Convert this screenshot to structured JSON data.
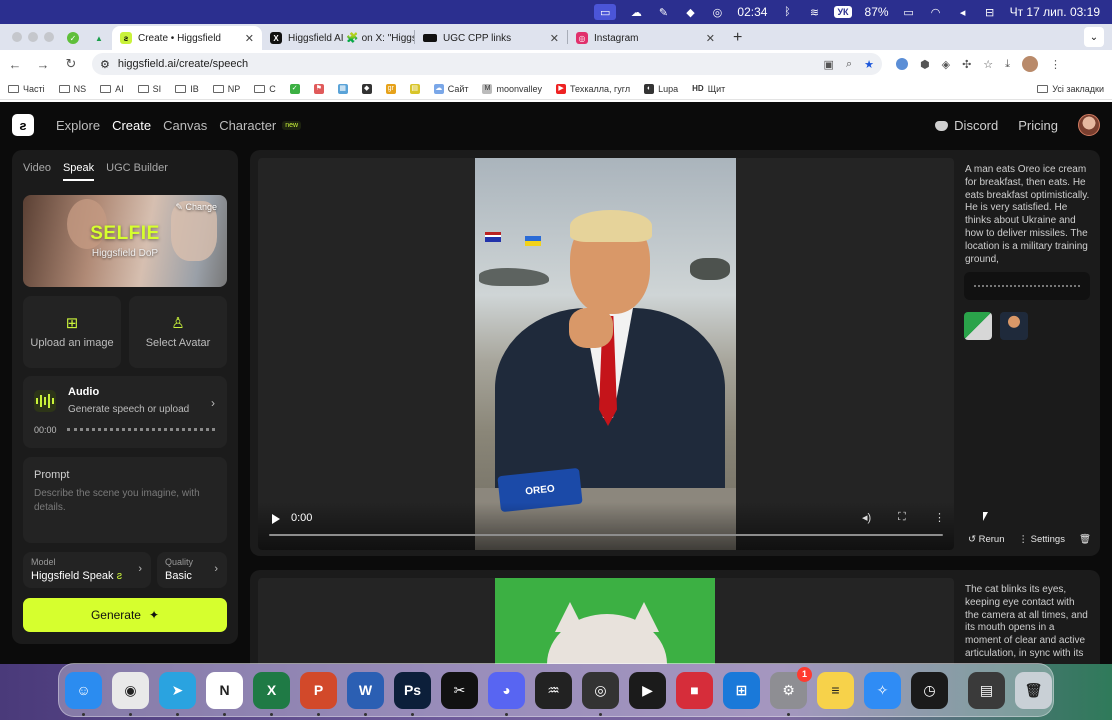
{
  "menubar": {
    "time": "02:34",
    "lang": "УК",
    "battery": "87%",
    "datetime": "Чт 17 лип.  03:19"
  },
  "browser": {
    "tabs": [
      {
        "label": "Create • Higgsfield",
        "active": true,
        "favicon_color": "#c9f23a"
      },
      {
        "label": "Higgsfield AI 🧩 on X: \"Higgs",
        "active": false,
        "favicon_color": "#111111"
      },
      {
        "label": "UGC CPP links",
        "active": false,
        "favicon_color": "#111111"
      },
      {
        "label": "Instagram",
        "active": false,
        "favicon_color": "#e1306c"
      }
    ],
    "url": "higgsfield.ai/create/speech",
    "bookmarks": [
      "Часті",
      "NS",
      "AI",
      "SI",
      "IB",
      "NP",
      "C",
      "",
      "",
      "",
      "",
      "",
      "Сайт",
      "moonvalley",
      "Техкалла, гугл",
      "Lupa",
      "Щит"
    ],
    "all_bookmarks": "Усі закладки"
  },
  "nav": {
    "links": [
      "Explore",
      "Create",
      "Canvas",
      "Character"
    ],
    "new_badge": "new",
    "discord": "Discord",
    "pricing": "Pricing"
  },
  "left": {
    "tabs": [
      "Video",
      "Speak",
      "UGC Builder"
    ],
    "preset": {
      "title": "SELFIE",
      "subtitle": "Higgsfield DoP",
      "change": "Change"
    },
    "upload": "Upload an image",
    "avatar": "Select Avatar",
    "audio": {
      "title": "Audio",
      "subtitle": "Generate speech or upload",
      "time": "00:00"
    },
    "prompt": {
      "label": "Prompt",
      "placeholder": "Describe the scene you imagine, with details."
    },
    "model": {
      "label": "Model",
      "value": "Higgsfield Speak"
    },
    "quality": {
      "label": "Quality",
      "value": "Basic"
    },
    "generate": "Generate"
  },
  "results": [
    {
      "time": "0:00",
      "description": "A man eats Oreo ice cream for breakfast, then eats. He eats breakfast optimistically. He is very satisfied. He thinks about Ukraine and how to deliver missiles. The location is a military training ground,",
      "package_text": "OREO",
      "rerun": "Rerun",
      "settings": "Settings"
    },
    {
      "description": "The cat blinks its eyes, keeping eye contact with the camera at all times, and its mouth opens in a moment of clear and active articulation, in sync with its"
    }
  ],
  "dock": {
    "apps": [
      {
        "name": "finder",
        "color": "#2b8cf0",
        "glyph": "☺"
      },
      {
        "name": "chrome",
        "color": "#e9e9e9",
        "glyph": "◉"
      },
      {
        "name": "telegram",
        "color": "#2aa3e0",
        "glyph": "➤"
      },
      {
        "name": "notion",
        "color": "#ffffff",
        "glyph": "N"
      },
      {
        "name": "excel",
        "color": "#1f7a45",
        "glyph": "X"
      },
      {
        "name": "powerpoint",
        "color": "#d2492a",
        "glyph": "P"
      },
      {
        "name": "word",
        "color": "#2b5fb3",
        "glyph": "W"
      },
      {
        "name": "photoshop",
        "color": "#0c1f3a",
        "glyph": "Ps"
      },
      {
        "name": "capcut",
        "color": "#111111",
        "glyph": "✂"
      },
      {
        "name": "discord",
        "color": "#5865f2",
        "glyph": "◕"
      },
      {
        "name": "audio",
        "color": "#222222",
        "glyph": "♒"
      },
      {
        "name": "obs",
        "color": "#333333",
        "glyph": "◎"
      },
      {
        "name": "player",
        "color": "#1b1b1b",
        "glyph": "▶"
      },
      {
        "name": "stop",
        "color": "#d62d3a",
        "glyph": "■"
      },
      {
        "name": "windows",
        "color": "#1a79d9",
        "glyph": "⊞"
      },
      {
        "name": "settings",
        "color": "#8e8e93",
        "glyph": "⚙",
        "badge": "1"
      },
      {
        "name": "notes",
        "color": "#f7d24a",
        "glyph": "≡"
      },
      {
        "name": "safari",
        "color": "#2f8cf5",
        "glyph": "✧"
      },
      {
        "name": "clock",
        "color": "#1a1a1a",
        "glyph": "◷"
      },
      {
        "name": "preview",
        "color": "#3a3a3a",
        "glyph": "▤"
      },
      {
        "name": "trash",
        "color": "#c9d0d6",
        "glyph": "🗑"
      }
    ]
  }
}
